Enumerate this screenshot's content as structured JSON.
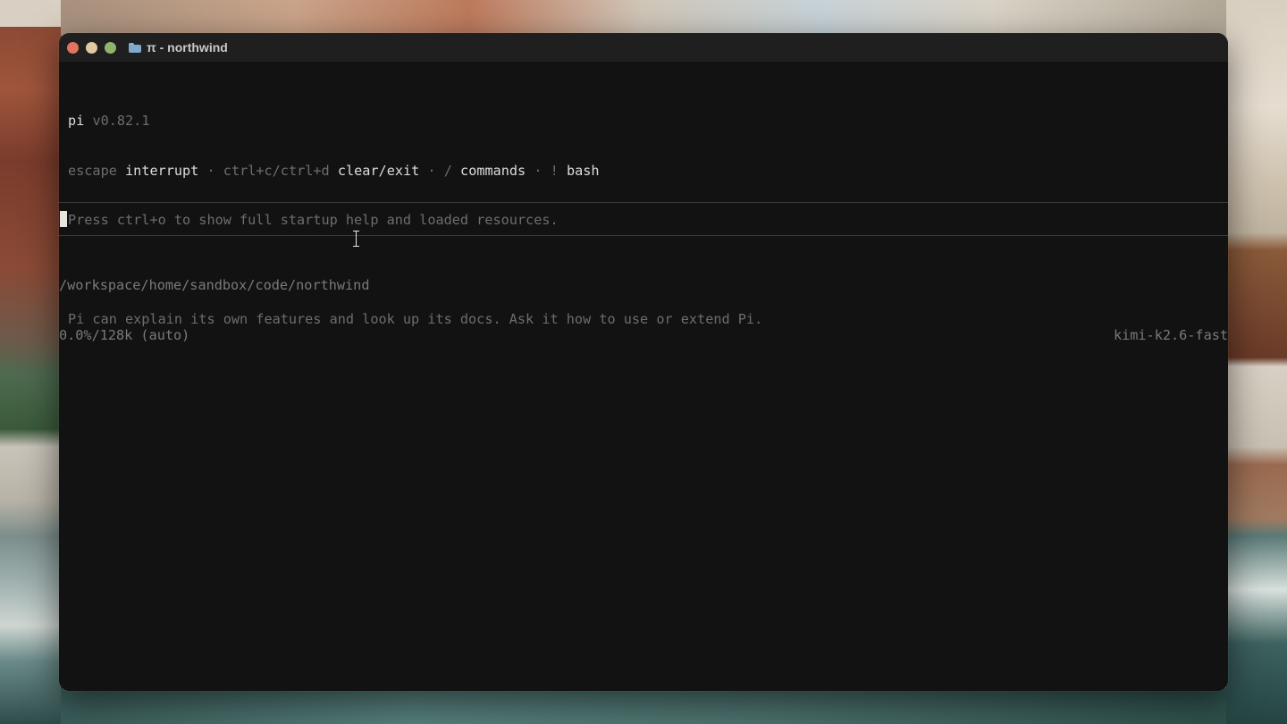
{
  "window": {
    "title": "π - northwind"
  },
  "header": {
    "app_name": "pi",
    "version": "v0.82.1",
    "shortcuts": [
      {
        "key": "escape",
        "action": "interrupt"
      },
      {
        "key": "ctrl+c/ctrl+d",
        "action": "clear/exit"
      },
      {
        "key": "/",
        "action": "commands"
      },
      {
        "key": "!",
        "action": "bash"
      }
    ],
    "separator": "·",
    "help_hint": "Press ctrl+o to show full startup help and loaded resources.",
    "tip": "Pi can explain its own features and look up its docs. Ask it how to use or extend Pi."
  },
  "input": {
    "value": ""
  },
  "footer": {
    "cwd": "/workspace/home/sandbox/code/northwind",
    "context_usage": "0.0%/128k (auto)",
    "model": "kimi-k2.6-fast"
  },
  "colors": {
    "terminal_bg": "#121212",
    "titlebar_bg": "#1f1f1f",
    "text_bright": "#dcdcdc",
    "text_dim": "#7a7a7a",
    "cursor": "#e8e6dc"
  }
}
